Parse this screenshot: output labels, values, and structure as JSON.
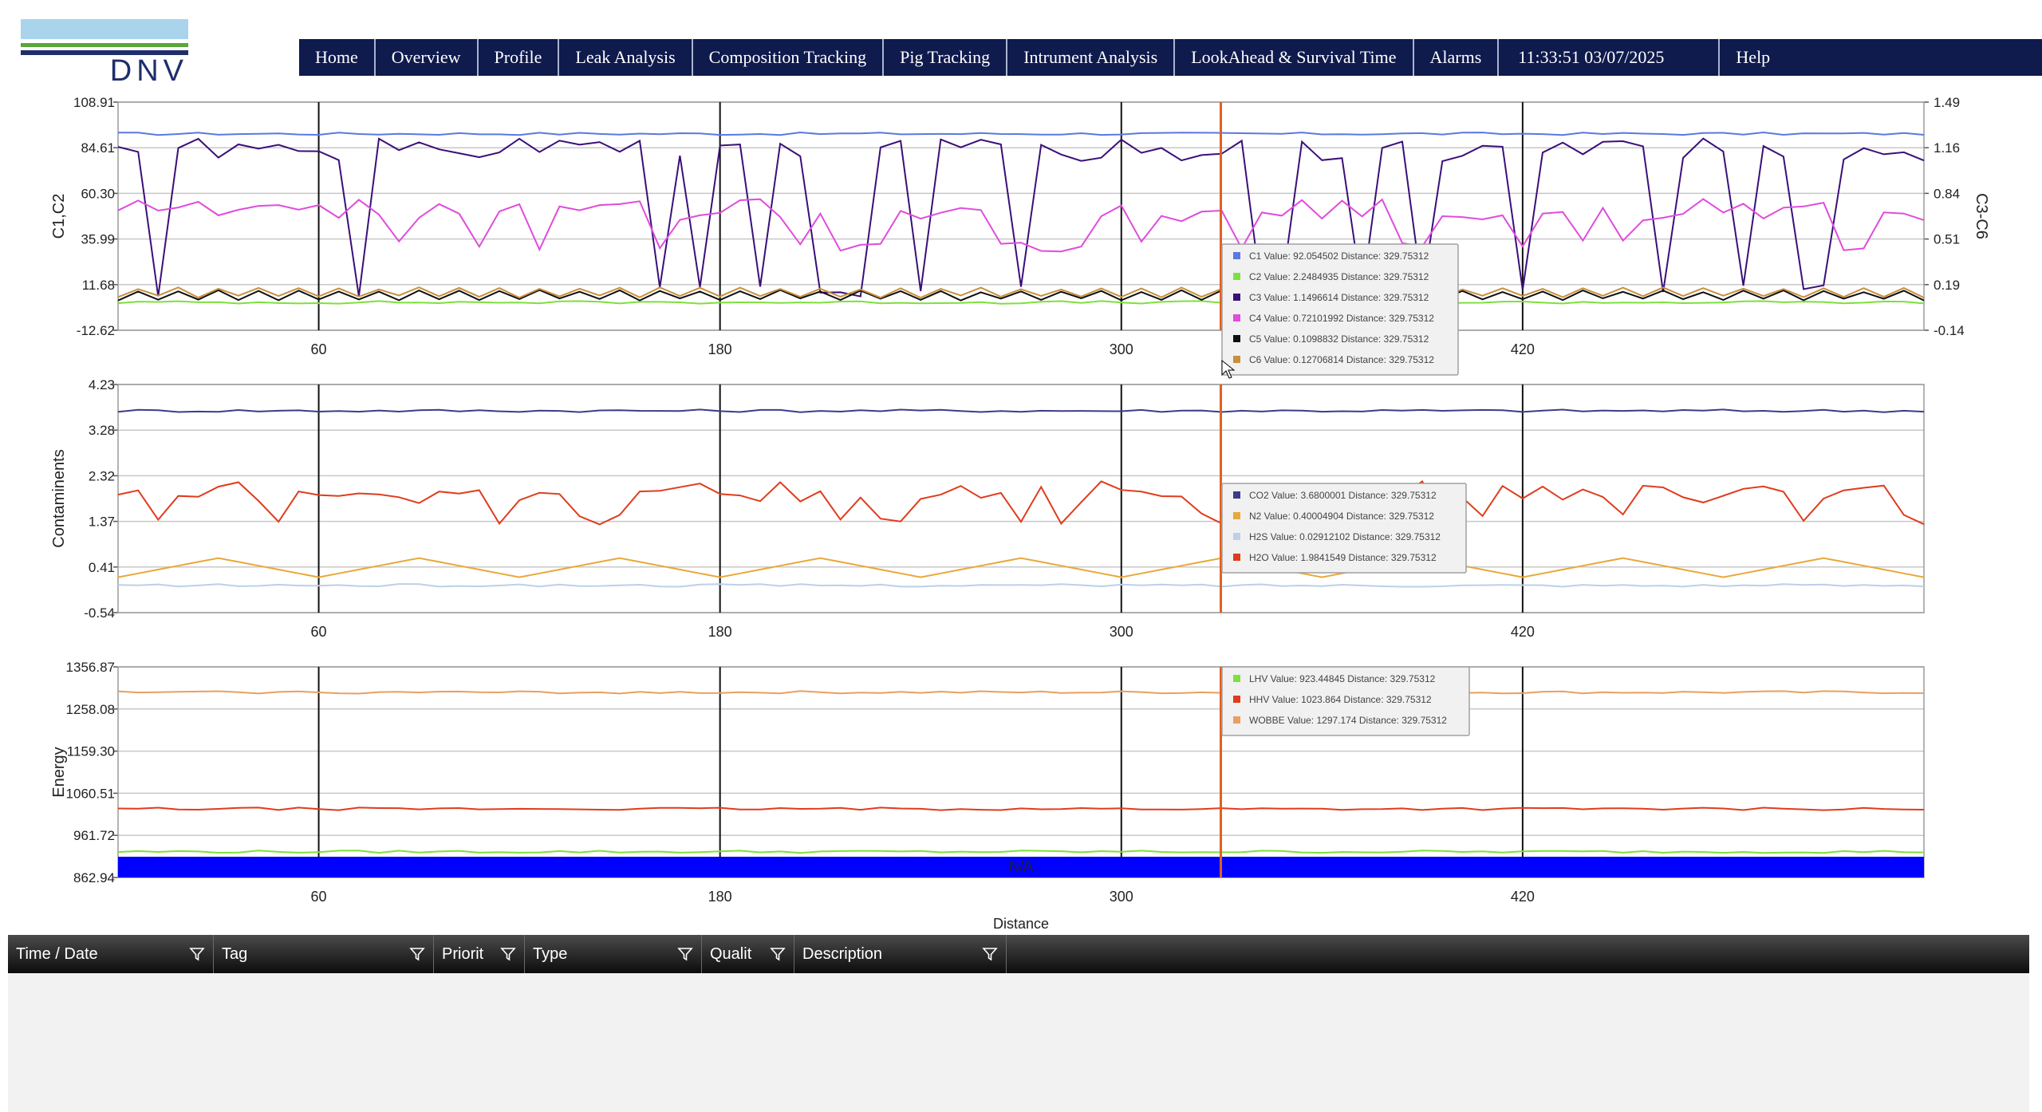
{
  "logo": {
    "text": "DNV"
  },
  "nav": {
    "items": [
      "Home",
      "Overview",
      "Profile",
      "Leak Analysis",
      "Composition Tracking",
      "Pig Tracking",
      "Intrument Analysis",
      "LookAhead & Survival Time",
      "Alarms"
    ],
    "clock": "11:33:51 03/07/2025",
    "help": "Help"
  },
  "colors": {
    "nav_bg": "#0f1a4d",
    "C1": "#5a78e0",
    "C2": "#7ee03c",
    "C3": "#3a0f78",
    "C4": "#e04cdc",
    "C5": "#101010",
    "C6": "#c8903c",
    "CO2": "#3c3c8a",
    "N2": "#e8a83a",
    "H2S": "#bcd0e8",
    "H2O": "#e03c1c",
    "LHV": "#7ee03c",
    "HHV": "#e03c1c",
    "WOBBE": "#e8a060",
    "cursor": "#e06020",
    "na_band": "#0000ff"
  },
  "chart_data": [
    {
      "type": "line",
      "ylabel": "C1,C2",
      "ylabel_right": "C3-C6",
      "x_ticks": [
        60,
        180,
        300,
        420
      ],
      "y_ticks_left": [
        "108.91",
        "84.61",
        "60.30",
        "35.99",
        "11.68",
        "-12.62"
      ],
      "y_ticks_right": [
        "1.49",
        "1.16",
        "0.84",
        "0.51",
        "0.19",
        "-0.14"
      ],
      "ylim": [
        -12.62,
        108.91
      ],
      "ylim_right": [
        -0.14,
        1.49
      ],
      "xlim": [
        0,
        540
      ],
      "cursor_x": 329.75312,
      "series": [
        {
          "name": "C1",
          "axis": "left",
          "approx_value": 92.05,
          "pattern": "flat"
        },
        {
          "name": "C2",
          "axis": "left",
          "approx_value": 2.25,
          "pattern": "flat"
        },
        {
          "name": "C3",
          "axis": "right",
          "approx_value": 1.15,
          "pattern": "dips",
          "low": 0.1
        },
        {
          "name": "C4",
          "axis": "right",
          "approx_value": 0.72,
          "pattern": "dips",
          "low": 0.42
        },
        {
          "name": "C5",
          "axis": "right",
          "approx_value": 0.11,
          "pattern": "zigzag"
        },
        {
          "name": "C6",
          "axis": "right",
          "approx_value": 0.13,
          "pattern": "zigzag"
        }
      ],
      "tooltip": [
        {
          "series": "C1",
          "text": "C1 Value: 92.054502 Distance: 329.75312"
        },
        {
          "series": "C2",
          "text": "C2 Value: 2.2484935 Distance: 329.75312"
        },
        {
          "series": "C3",
          "text": "C3 Value: 1.1496614 Distance: 329.75312"
        },
        {
          "series": "C4",
          "text": "C4 Value: 0.72101992 Distance: 329.75312"
        },
        {
          "series": "C5",
          "text": "C5 Value: 0.1098832 Distance: 329.75312"
        },
        {
          "series": "C6",
          "text": "C6 Value: 0.12706814 Distance: 329.75312"
        }
      ]
    },
    {
      "type": "line",
      "ylabel": "Contaminents",
      "x_ticks": [
        60,
        180,
        300,
        420
      ],
      "y_ticks_left": [
        "4.23",
        "3.28",
        "2.32",
        "1.37",
        "0.41",
        "-0.54"
      ],
      "ylim": [
        -0.54,
        4.23
      ],
      "xlim": [
        0,
        540
      ],
      "cursor_x": 329.75312,
      "series": [
        {
          "name": "CO2",
          "approx_value": 3.68,
          "pattern": "flat"
        },
        {
          "name": "N2",
          "approx_value": 0.4,
          "pattern": "triangle",
          "low": 0.2,
          "high": 0.6
        },
        {
          "name": "H2S",
          "approx_value": 0.03,
          "pattern": "flat"
        },
        {
          "name": "H2O",
          "approx_value": 1.98,
          "pattern": "dips",
          "low": 1.3
        }
      ],
      "tooltip": [
        {
          "series": "CO2",
          "text": "CO2 Value: 3.6800001 Distance: 329.75312"
        },
        {
          "series": "N2",
          "text": "N2 Value: 0.40004904 Distance: 329.75312"
        },
        {
          "series": "H2S",
          "text": "H2S Value: 0.02912102 Distance: 329.75312"
        },
        {
          "series": "H2O",
          "text": "H2O Value: 1.9841549 Distance: 329.75312"
        }
      ]
    },
    {
      "type": "line",
      "ylabel": "Energy",
      "xlabel": "Distance",
      "x_ticks": [
        60,
        180,
        300,
        420
      ],
      "y_ticks_left": [
        "1356.87",
        "1258.08",
        "1159.30",
        "1060.51",
        "961.72",
        "862.94"
      ],
      "ylim": [
        862.94,
        1356.87
      ],
      "xlim": [
        0,
        540
      ],
      "cursor_x": 329.75312,
      "na_band_label": "N/A",
      "series": [
        {
          "name": "LHV",
          "approx_value": 923.45,
          "pattern": "flat"
        },
        {
          "name": "HHV",
          "approx_value": 1023.86,
          "pattern": "flat"
        },
        {
          "name": "WOBBE",
          "approx_value": 1297.17,
          "pattern": "flat"
        }
      ],
      "tooltip": [
        {
          "series": "LHV",
          "text": "LHV Value: 923.44845 Distance: 329.75312"
        },
        {
          "series": "HHV",
          "text": "HHV Value: 1023.864 Distance: 329.75312"
        },
        {
          "series": "WOBBE",
          "text": "WOBBE Value: 1297.174 Distance: 329.75312"
        }
      ]
    }
  ],
  "alarm_table": {
    "columns": [
      "Time / Date",
      "Tag",
      "Priorit",
      "Type",
      "Qualit",
      "Description"
    ],
    "rows": []
  }
}
